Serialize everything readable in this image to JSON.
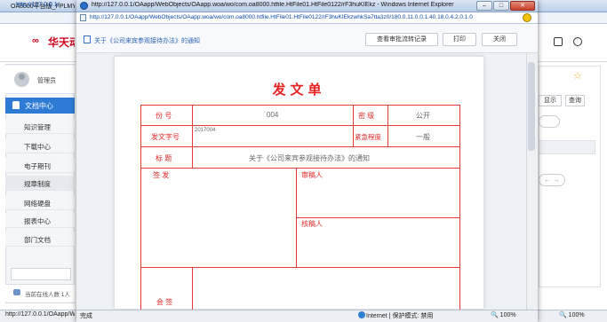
{
  "background_window": {
    "title": "OA8000平台版_FPLMYS",
    "address": "http://127.0.0.1/",
    "logo_text": "华天动",
    "user": "管理员",
    "sidebar": {
      "active": "文档中心",
      "items": [
        "知识管理",
        "下载中心",
        "电子期刊",
        "规章制度",
        "网络硬盘",
        "报表中心",
        "部门文档"
      ]
    },
    "online_text": "当前在线人数 1人",
    "status_text": "http://127.0.0.1/OAapp/We",
    "right": {
      "show_btn": "显示",
      "query_btn": "查询",
      "zoom": "100%"
    }
  },
  "popup": {
    "title": "http://127.0.0.1/OAapp/WebObjects/OAapp.woa/wo/com.oa8000.htfile.HtFile01.HtFile0122/rF3huKIEkz - Windows Internet Explorer",
    "address": "http://127.0.0.1/OAapp/WebObjects/OAapp.woa/wo/com.oa8000.htfile.HtFile01.HtFile0122/rF3huKIEkzwhkSa7tta3z0/180.0.11.0.0.1.40.18.0.4.2.0.1.0",
    "toolbar": {
      "doc_title": "关于《公司来宾参观接待办法》的通知",
      "view_record": "查看审批流转记录",
      "print": "打印",
      "close": "关闭"
    },
    "form": {
      "title": "发文单",
      "labels": {
        "number": "份 号",
        "secret": "密 级",
        "doc_no": "发文字号",
        "urgency": "紧急程度",
        "subject": "标 题",
        "sign": "签 发",
        "review": "审稿人",
        "proof": "核稿人",
        "countersign": "会 签"
      },
      "values": {
        "number": "004",
        "secret": "公开",
        "doc_no": "2017004",
        "urgency": "一般",
        "subject": "关于《公司来宾参观接待办法》的通知"
      }
    },
    "status": {
      "done": "完成",
      "zone": "Internet | 保护模式: 禁用",
      "zoom": "100%"
    }
  }
}
